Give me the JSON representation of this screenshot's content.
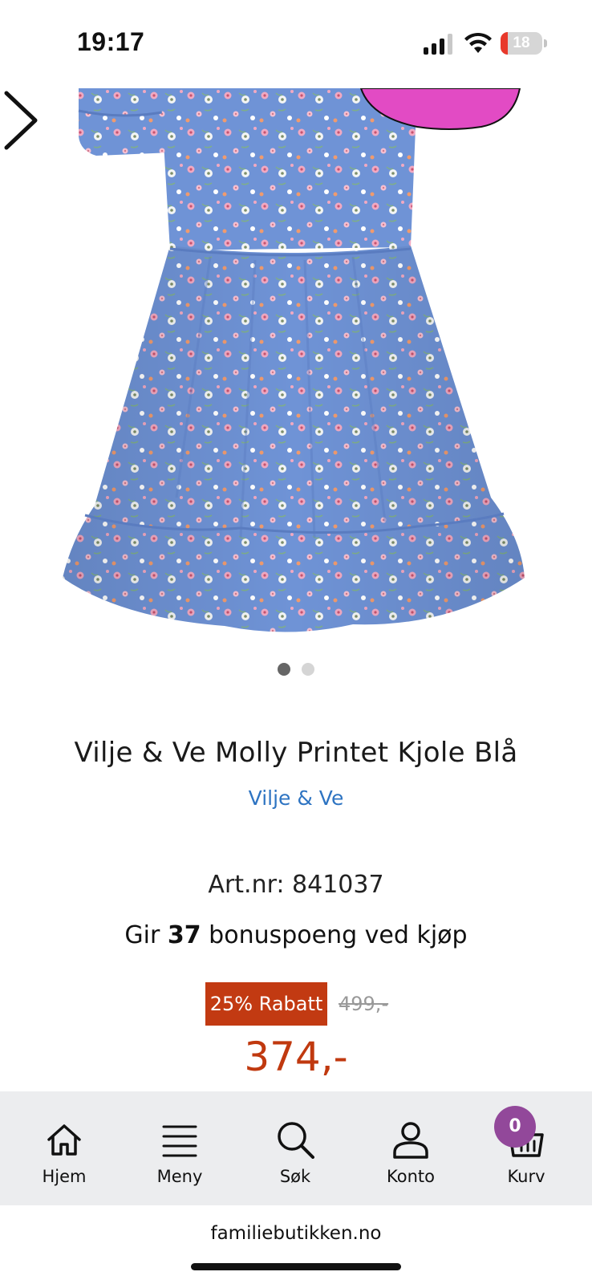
{
  "status_bar": {
    "time": "19:17",
    "battery_level": "18",
    "battery_fraction": 0.18
  },
  "product": {
    "image_count": 2,
    "active_image_index": 0,
    "title": "Vilje & Ve Molly Printet Kjole Blå",
    "brand": "Vilje & Ve",
    "art_nr": "Art.nr: 841037",
    "bonus_prefix": "Gir",
    "bonus_points": "37",
    "bonus_suffix": "bonuspoeng ved kjøp",
    "discount_label": "25% Rabatt",
    "old_price": "499,-",
    "price": "374,-"
  },
  "bottom_nav": {
    "items": [
      {
        "label": "Hjem",
        "icon": "home-icon"
      },
      {
        "label": "Meny",
        "icon": "menu-icon"
      },
      {
        "label": "Søk",
        "icon": "search-icon"
      },
      {
        "label": "Konto",
        "icon": "account-icon"
      },
      {
        "label": "Kurv",
        "icon": "basket-icon"
      }
    ],
    "cart_count": "0"
  },
  "browser": {
    "url": "familiebutikken.no"
  },
  "colors": {
    "dress": "#6f93d6",
    "badge_pink": "#e24bc4",
    "discount": "#c23a12",
    "price": "#c0390f",
    "brand_link": "#2e74c2",
    "cart_badge": "#92489a",
    "nav_bg": "#ecedef"
  }
}
